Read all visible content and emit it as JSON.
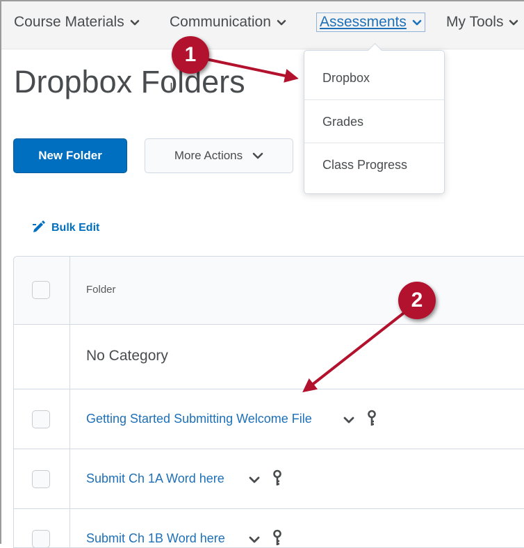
{
  "nav": {
    "items": [
      {
        "label": "Course Materials"
      },
      {
        "label": "Communication"
      },
      {
        "label": "Assessments"
      },
      {
        "label": "My Tools"
      }
    ],
    "active": "Assessments"
  },
  "dropdown": {
    "items": [
      {
        "label": "Dropbox"
      },
      {
        "label": "Grades"
      },
      {
        "label": "Class Progress"
      }
    ]
  },
  "page": {
    "title": "Dropbox Folders"
  },
  "toolbar": {
    "new_folder_label": "New Folder",
    "more_actions_label": "More Actions"
  },
  "bulk_edit_label": "Bulk Edit",
  "table": {
    "header": "Folder",
    "category": "No Category",
    "rows": [
      {
        "name": "Getting Started Submitting Welcome File"
      },
      {
        "name": "Submit Ch 1A Word here"
      },
      {
        "name": "Submit Ch 1B Word here"
      }
    ]
  },
  "annotations": {
    "marker_1": "1",
    "marker_2": "2"
  },
  "colors": {
    "accent": "#006fbf",
    "link": "#1d70b8",
    "annotation": "#b3122e"
  },
  "icons": [
    "chevron-down-icon",
    "pencil-icon",
    "key-icon",
    "arrow-icon"
  ]
}
